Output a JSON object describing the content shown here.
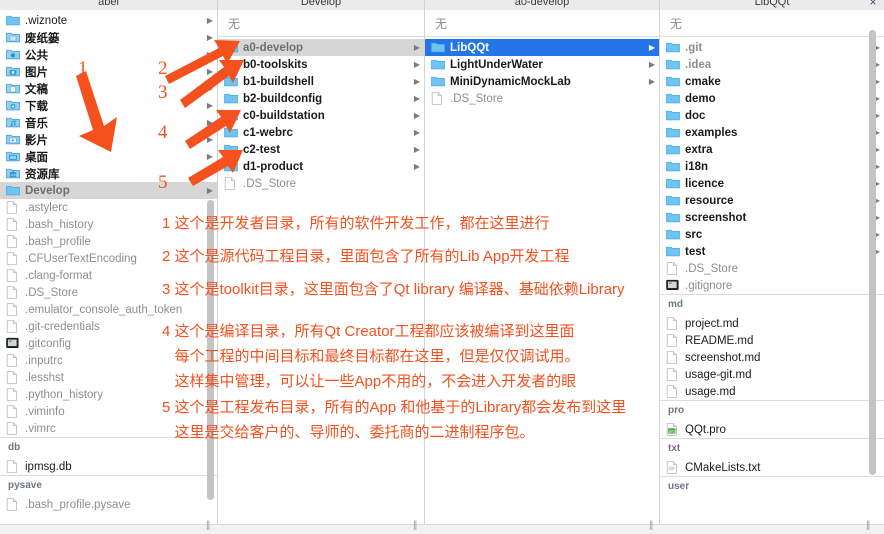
{
  "window": {
    "close_label": "×",
    "columns_headers": [
      "abel",
      "Develop",
      "a0-develop",
      "LibQQt"
    ],
    "filter_placeholder": "无"
  },
  "colors": {
    "selection_blue": "#2475e8",
    "selection_gray": "#d6d6d6",
    "annotation_orange": "#f4511e",
    "folder_blue": "#6ec4f2",
    "group_head": "#6c7684"
  },
  "column1": {
    "header": "abel",
    "filter": "无",
    "items": [
      {
        "name": ".wiznote",
        "icon": "folder-icon",
        "disclosure": "▶",
        "style": "normal"
      },
      {
        "name": "废纸篓",
        "icon": "folder-trash-icon",
        "disclosure": "▶",
        "style": "bold"
      },
      {
        "name": "公共",
        "icon": "folder-public-icon",
        "disclosure": "▶",
        "style": "bold"
      },
      {
        "name": "图片",
        "icon": "folder-pictures-icon",
        "disclosure": "▶",
        "style": "bold"
      },
      {
        "name": "文稿",
        "icon": "folder-documents-icon",
        "disclosure": "▶",
        "style": "bold"
      },
      {
        "name": "下载",
        "icon": "folder-downloads-icon",
        "disclosure": "▶",
        "style": "bold"
      },
      {
        "name": "音乐",
        "icon": "folder-music-icon",
        "disclosure": "▶",
        "style": "bold"
      },
      {
        "name": "影片",
        "icon": "folder-movies-icon",
        "disclosure": "▶",
        "style": "bold"
      },
      {
        "name": "桌面",
        "icon": "folder-desktop-icon",
        "disclosure": "▶",
        "style": "bold"
      },
      {
        "name": "资源库",
        "icon": "folder-library-icon",
        "disclosure": "▶",
        "style": "bold"
      },
      {
        "name": "Develop",
        "icon": "folder-icon",
        "disclosure": "▶",
        "style": "selected-gray"
      },
      {
        "name": ".astylerc",
        "icon": "file-icon",
        "disclosure": "",
        "style": "muted"
      },
      {
        "name": ".bash_history",
        "icon": "file-icon",
        "disclosure": "",
        "style": "muted"
      },
      {
        "name": ".bash_profile",
        "icon": "file-icon",
        "disclosure": "",
        "style": "muted"
      },
      {
        "name": ".CFUserTextEncoding",
        "icon": "file-icon",
        "disclosure": "",
        "style": "muted"
      },
      {
        "name": ".clang-format",
        "icon": "file-icon",
        "disclosure": "",
        "style": "muted"
      },
      {
        "name": ".DS_Store",
        "icon": "file-icon",
        "disclosure": "",
        "style": "muted"
      },
      {
        "name": ".emulator_console_auth_token",
        "icon": "file-icon",
        "disclosure": "",
        "style": "muted"
      },
      {
        "name": ".git-credentials",
        "icon": "file-icon",
        "disclosure": "",
        "style": "muted"
      },
      {
        "name": ".gitconfig",
        "icon": "terminal-file-icon",
        "disclosure": "",
        "style": "muted"
      },
      {
        "name": ".inputrc",
        "icon": "file-icon",
        "disclosure": "",
        "style": "muted"
      },
      {
        "name": ".lesshst",
        "icon": "file-icon",
        "disclosure": "",
        "style": "muted"
      },
      {
        "name": ".python_history",
        "icon": "file-icon",
        "disclosure": "",
        "style": "muted"
      },
      {
        "name": ".viminfo",
        "icon": "file-icon",
        "disclosure": "",
        "style": "muted"
      },
      {
        "name": ".vimrc",
        "icon": "file-icon",
        "disclosure": "",
        "style": "muted"
      }
    ],
    "groups": [
      {
        "title": "db",
        "items": [
          {
            "name": "ipmsg.db",
            "icon": "file-icon",
            "style": "normal"
          }
        ]
      },
      {
        "title": "pysave",
        "items": [
          {
            "name": ".bash_profile.pysave",
            "icon": "file-icon",
            "style": "muted"
          }
        ]
      }
    ]
  },
  "column2": {
    "header": "Develop",
    "filter": "无",
    "items": [
      {
        "name": "a0-develop",
        "icon": "folder-icon",
        "disclosure": "▶",
        "style": "selected-gray"
      },
      {
        "name": "b0-toolskits",
        "icon": "folder-icon",
        "disclosure": "▶",
        "style": "bold"
      },
      {
        "name": "b1-buildshell",
        "icon": "folder-icon",
        "disclosure": "▶",
        "style": "bold"
      },
      {
        "name": "b2-buildconfig",
        "icon": "folder-icon",
        "disclosure": "▶",
        "style": "bold"
      },
      {
        "name": "c0-buildstation",
        "icon": "folder-icon",
        "disclosure": "▶",
        "style": "bold"
      },
      {
        "name": "c1-webrc",
        "icon": "folder-icon",
        "disclosure": "▶",
        "style": "bold"
      },
      {
        "name": "c2-test",
        "icon": "folder-icon",
        "disclosure": "▶",
        "style": "bold"
      },
      {
        "name": "d1-product",
        "icon": "folder-icon",
        "disclosure": "▶",
        "style": "bold"
      },
      {
        "name": ".DS_Store",
        "icon": "file-icon",
        "disclosure": "",
        "style": "muted"
      }
    ]
  },
  "column3": {
    "header": "a0-develop",
    "filter": "无",
    "items": [
      {
        "name": "LibQQt",
        "icon": "folder-icon",
        "disclosure": "▶",
        "style": "selected-blue"
      },
      {
        "name": "LightUnderWater",
        "icon": "folder-icon",
        "disclosure": "▶",
        "style": "bold"
      },
      {
        "name": "MiniDynamicMockLab",
        "icon": "folder-icon",
        "disclosure": "▶",
        "style": "bold"
      },
      {
        "name": ".DS_Store",
        "icon": "file-icon",
        "disclosure": "",
        "style": "muted"
      }
    ]
  },
  "column4": {
    "header": "LibQQt",
    "filter": "无",
    "items": [
      {
        "name": ".git",
        "icon": "folder-icon",
        "disclosure": "▶",
        "style": "muted-bold"
      },
      {
        "name": ".idea",
        "icon": "folder-icon",
        "disclosure": "▶",
        "style": "muted-bold"
      },
      {
        "name": "cmake",
        "icon": "folder-icon",
        "disclosure": "▶",
        "style": "bold"
      },
      {
        "name": "demo",
        "icon": "folder-icon",
        "disclosure": "▶",
        "style": "bold"
      },
      {
        "name": "doc",
        "icon": "folder-icon",
        "disclosure": "▶",
        "style": "bold"
      },
      {
        "name": "examples",
        "icon": "folder-icon",
        "disclosure": "▶",
        "style": "bold"
      },
      {
        "name": "extra",
        "icon": "folder-icon",
        "disclosure": "▶",
        "style": "bold"
      },
      {
        "name": "i18n",
        "icon": "folder-icon",
        "disclosure": "▶",
        "style": "bold"
      },
      {
        "name": "licence",
        "icon": "folder-icon",
        "disclosure": "▶",
        "style": "bold"
      },
      {
        "name": "resource",
        "icon": "folder-icon",
        "disclosure": "▶",
        "style": "bold"
      },
      {
        "name": "screenshot",
        "icon": "folder-icon",
        "disclosure": "▶",
        "style": "bold"
      },
      {
        "name": "src",
        "icon": "folder-icon",
        "disclosure": "▶",
        "style": "bold"
      },
      {
        "name": "test",
        "icon": "folder-icon",
        "disclosure": "▶",
        "style": "bold"
      },
      {
        "name": ".DS_Store",
        "icon": "file-icon",
        "disclosure": "",
        "style": "muted"
      },
      {
        "name": ".gitignore",
        "icon": "terminal-file-icon",
        "disclosure": "",
        "style": "muted"
      }
    ],
    "groups": [
      {
        "title": "md",
        "items": [
          {
            "name": "project.md",
            "icon": "file-icon",
            "style": "normal"
          },
          {
            "name": "README.md",
            "icon": "file-icon",
            "style": "normal"
          },
          {
            "name": "screenshot.md",
            "icon": "file-icon",
            "style": "normal"
          },
          {
            "name": "usage-git.md",
            "icon": "file-icon",
            "style": "normal"
          },
          {
            "name": "usage.md",
            "icon": "file-icon",
            "style": "normal"
          }
        ]
      },
      {
        "title": "pro",
        "items": [
          {
            "name": "QQt.pro",
            "icon": "pro-file-icon",
            "style": "normal"
          }
        ]
      },
      {
        "title": "txt",
        "items": [
          {
            "name": "CMakeLists.txt",
            "icon": "text-file-icon",
            "style": "normal"
          }
        ]
      },
      {
        "title": "user",
        "items": []
      }
    ]
  },
  "annotations": {
    "markers": [
      {
        "id": "1",
        "label": "1"
      },
      {
        "id": "2",
        "label": "2"
      },
      {
        "id": "3",
        "label": "3"
      },
      {
        "id": "4",
        "label": "4"
      },
      {
        "id": "5",
        "label": "5"
      }
    ],
    "notes": [
      {
        "num": "1",
        "lines": [
          "1 这个是开发者目录，所有的软件开发工作，都在这里进行"
        ]
      },
      {
        "num": "2",
        "lines": [
          "2 这个是源代码工程目录，里面包含了所有的Lib App开发工程"
        ]
      },
      {
        "num": "3",
        "lines": [
          "3 这个是toolkit目录，这里面包含了Qt library 编译器、基础依赖Library"
        ]
      },
      {
        "num": "4",
        "lines": [
          "4 这个是编译目录，所有Qt Creator工程都应该被编译到这里面",
          "   每个工程的中间目标和最终目标都在这里，但是仅仅调试用。",
          "   这样集中管理，可以让一些App不用的，不会进入开发者的眼"
        ]
      },
      {
        "num": "5",
        "lines": [
          "5 这个是工程发布目录，所有的App 和他基于的Library都会发布到这里",
          "   这里是交给客户的、导师的、委托商的二进制程序包。"
        ]
      }
    ]
  }
}
